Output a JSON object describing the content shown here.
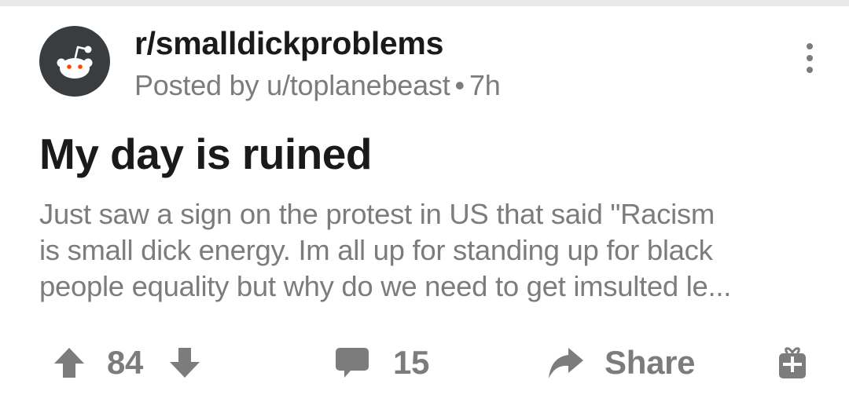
{
  "post": {
    "subreddit": "r/smalldickproblems",
    "posted_by_prefix": "Posted by",
    "author": "u/toplanebeast",
    "separator": "•",
    "age": "7h",
    "title": "My day is ruined",
    "body_lines": [
      "Just saw a sign on the protest in US that said \"Racism",
      "is small dick energy. Im all up for standing up for black",
      "people equality but why do we need to get imsulted le..."
    ]
  },
  "actions": {
    "score": "84",
    "comments": "15",
    "share_label": "Share"
  },
  "icons": {
    "avatar": "reddit-snoo-icon",
    "more": "more-vertical-icon",
    "upvote": "upvote-arrow-icon",
    "downvote": "downvote-arrow-icon",
    "comment": "comment-bubble-icon",
    "share": "share-arrow-icon",
    "award": "gift-award-icon"
  },
  "colors": {
    "text_primary": "#1a1a1b",
    "text_secondary": "#7c7c7c",
    "avatar_bg": "#3a3d40",
    "snoo_eyes": "#ff4500"
  }
}
